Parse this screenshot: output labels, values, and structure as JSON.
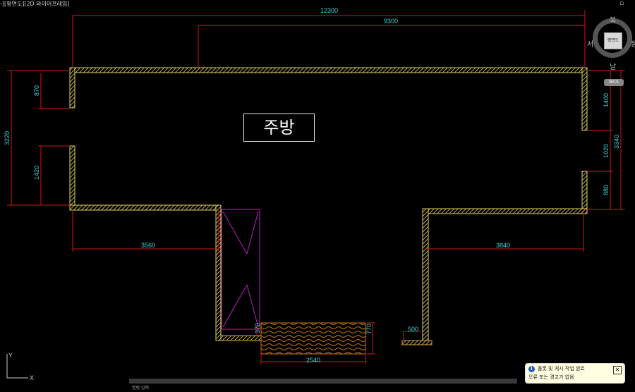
{
  "viewport": {
    "label": "-][평면도][2D 와이어프레임]"
  },
  "room": {
    "title": "주방"
  },
  "dimensions": {
    "top_overall": "12300",
    "top_inner": "9300",
    "left_overall": "3220",
    "left_upper": "870",
    "left_lower": "1420",
    "right_overall": "3340",
    "right_upper": "1400",
    "right_mid": "1020",
    "right_lower": "880",
    "bottom_left": "3560",
    "bottom_right": "3840",
    "door_small": "370",
    "wood_width": "2540",
    "wood_height": "770",
    "small_right": "500"
  },
  "viewcube": {
    "north": "북",
    "south": "남",
    "west": "서",
    "east": "동",
    "face": "평면도",
    "wcs": "WCS"
  },
  "ucs": {
    "x": "X",
    "y": "Y"
  },
  "statusbar": {
    "text": "명령 입력"
  },
  "notification": {
    "title": "플롯 및 게시 작업 완료",
    "body": "오류 또는 경고가 없음"
  },
  "colors": {
    "background": "#000000",
    "wall": "#e0d060",
    "dimension_line": "#d01818",
    "dimension_text": "#39d6d6",
    "door": "#c020c0",
    "wood": "#c87a10"
  }
}
